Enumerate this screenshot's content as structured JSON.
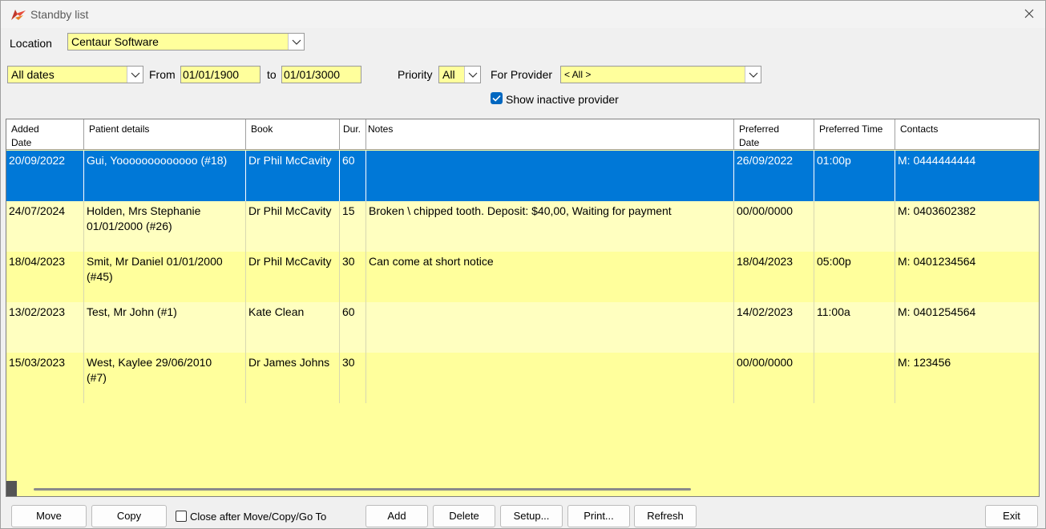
{
  "window": {
    "title": "Standby list"
  },
  "filters": {
    "location_label": "Location",
    "location_value": "Centaur Software",
    "date_range_value": "All dates",
    "from_label": "From",
    "from_value": "01/01/1900",
    "to_label": "to",
    "to_value": "01/01/3000",
    "priority_label": "Priority",
    "priority_value": "All",
    "provider_label": "For Provider",
    "provider_value": "< All >",
    "show_inactive_label": "Show inactive provider",
    "show_inactive_checked": true
  },
  "table": {
    "headers": {
      "added_line1": "Added",
      "added_line2": "Date",
      "patient": "Patient details",
      "book": "Book",
      "dur": "Dur.",
      "notes": "Notes",
      "preferred_date_line1": "Preferred",
      "preferred_date_line2": "Date",
      "preferred_time": "Preferred Time",
      "contacts": "Contacts"
    },
    "rows": [
      {
        "added": "20/09/2022",
        "patient_l1": "Gui, Yooooooooooooo (#18)",
        "patient_l2": "",
        "book": "Dr Phil McCavity",
        "dur": "60",
        "notes": "",
        "pref_date": "26/09/2022",
        "pref_time": "01:00p",
        "contact": "M: 0444444444"
      },
      {
        "added": "24/07/2024",
        "patient_l1": "Holden, Mrs Stephanie",
        "patient_l2": "01/01/2000 (#26)",
        "book": "Dr Phil McCavity",
        "dur": "15",
        "notes": "Broken \\ chipped tooth.  Deposit: $40,00, Waiting for payment",
        "pref_date": "00/00/0000",
        "pref_time": "",
        "contact": "M: 0403602382"
      },
      {
        "added": "18/04/2023",
        "patient_l1": "Smit, Mr Daniel 01/01/2000",
        "patient_l2": "(#45)",
        "book": "Dr Phil McCavity",
        "dur": "30",
        "notes": "Can come at short notice",
        "pref_date": "18/04/2023",
        "pref_time": "05:00p",
        "contact": "M: 0401234564"
      },
      {
        "added": "13/02/2023",
        "patient_l1": "Test, Mr John (#1)",
        "patient_l2": "",
        "book": "Kate Clean",
        "dur": "60",
        "notes": "",
        "pref_date": "14/02/2023",
        "pref_time": "11:00a",
        "contact": "M: 0401254564"
      },
      {
        "added": "15/03/2023",
        "patient_l1": "West, Kaylee 29/06/2010",
        "patient_l2": "(#7)",
        "book": "Dr James Johns",
        "dur": "30",
        "notes": "",
        "pref_date": "00/00/0000",
        "pref_time": "",
        "contact": "M: 123456"
      }
    ]
  },
  "buttons": {
    "move": "Move",
    "copy": "Copy",
    "close_after_label": "Close after Move/Copy/Go To",
    "add": "Add",
    "delete": "Delete",
    "setup": "Setup...",
    "print": "Print...",
    "refresh": "Refresh",
    "exit": "Exit"
  },
  "colors": {
    "selected_row": "#0078d7",
    "field_yellow": "#ffff9c",
    "checkbox_blue": "#0067c0"
  }
}
